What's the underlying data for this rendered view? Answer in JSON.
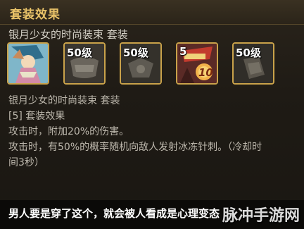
{
  "header": {
    "title": "套装效果"
  },
  "set_name_top": "银月少女的时尚装束 套装",
  "slots": [
    {
      "level": "",
      "icon": "character-portrait-icon"
    },
    {
      "level": "50级",
      "icon": "armor-piece-icon"
    },
    {
      "level": "50级",
      "icon": "armor-piece-icon"
    },
    {
      "level": "5",
      "icon": "special-item-icon",
      "badge": "10"
    },
    {
      "level": "50级",
      "icon": "armor-piece-icon"
    }
  ],
  "info": {
    "set_name": "银月少女的时尚装束 套装",
    "count_label": "[5] 套装效果",
    "effect1": "攻击时，附加20%的伤害。",
    "effect2_line1": "攻击时，有50%的概率随机向敌人发射冰冻针刺。（冷却时",
    "effect2_line2": "间3秒）"
  },
  "caption": "男人要是穿了这个，就会被人看成是心理变态",
  "watermark": "脉冲手游网"
}
